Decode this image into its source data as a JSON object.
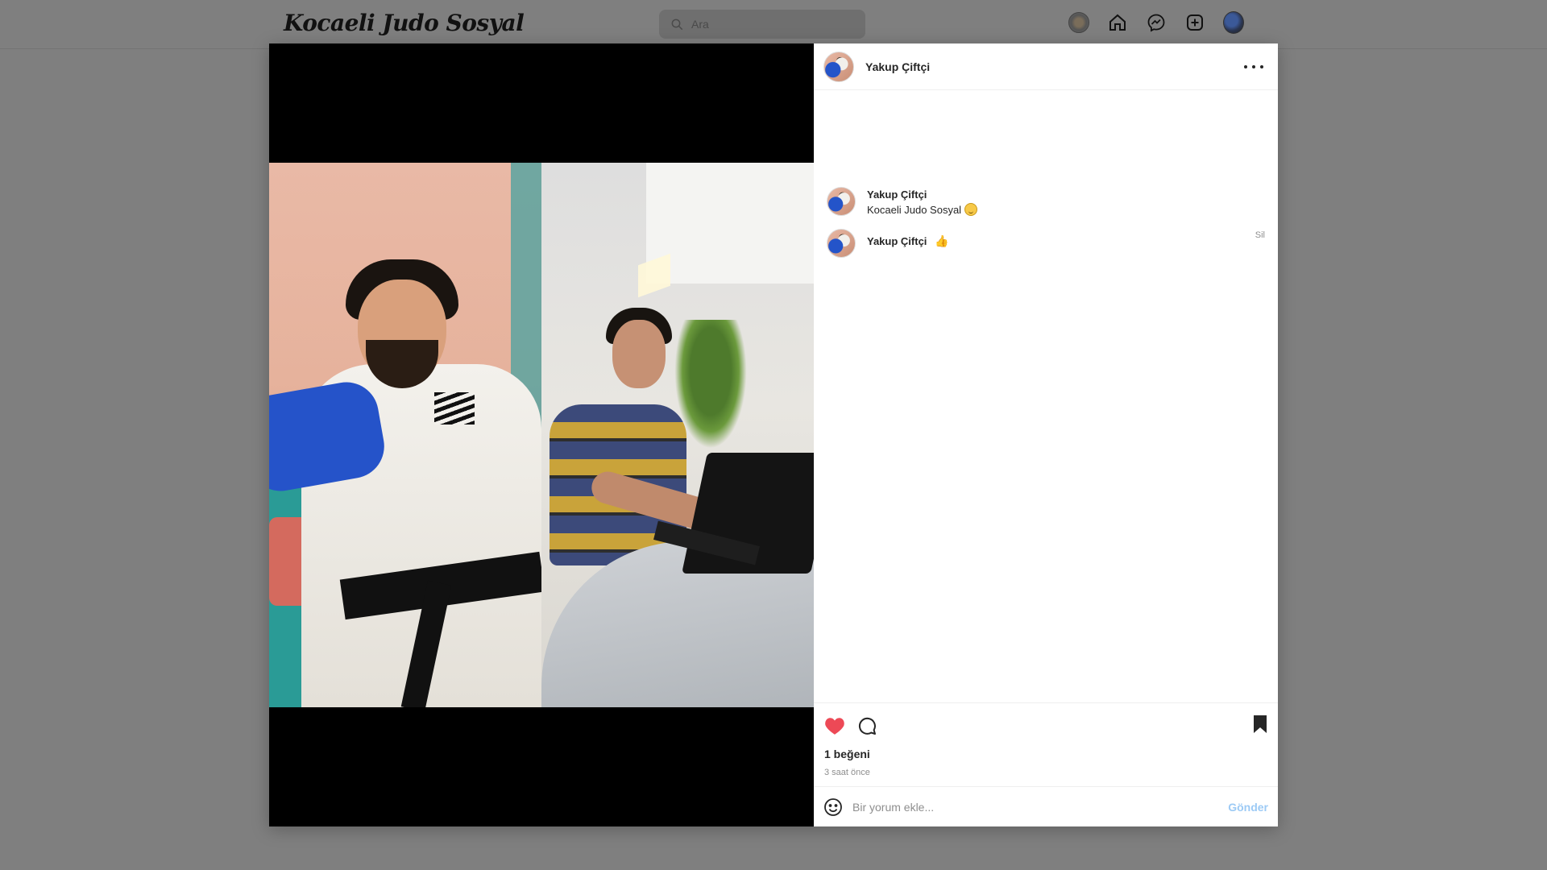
{
  "app": {
    "brand": "Kocaeli Judo Sosyal"
  },
  "search": {
    "placeholder": "Ara"
  },
  "nav": {
    "icons": [
      "globe-icon",
      "home-icon",
      "messenger-icon",
      "add-post-icon",
      "profile-avatar"
    ]
  },
  "post": {
    "author": "Yakup Çiftçi",
    "caption": {
      "author": "Yakup Çiftçi",
      "text": "Kocaeli Judo Sosyal"
    },
    "comments": [
      {
        "author": "Yakup Çiftçi",
        "delete_label": "Sil"
      }
    ],
    "likes_text": "1 beğeni",
    "time_text": "3 saat önce",
    "liked": true,
    "saved": true
  },
  "comment_box": {
    "placeholder": "Bir yorum ekle...",
    "send_label": "Gönder"
  },
  "colors": {
    "like": "#ed4956",
    "send_disabled": "#9ccaf5",
    "overlay": "#7f7f7f"
  }
}
